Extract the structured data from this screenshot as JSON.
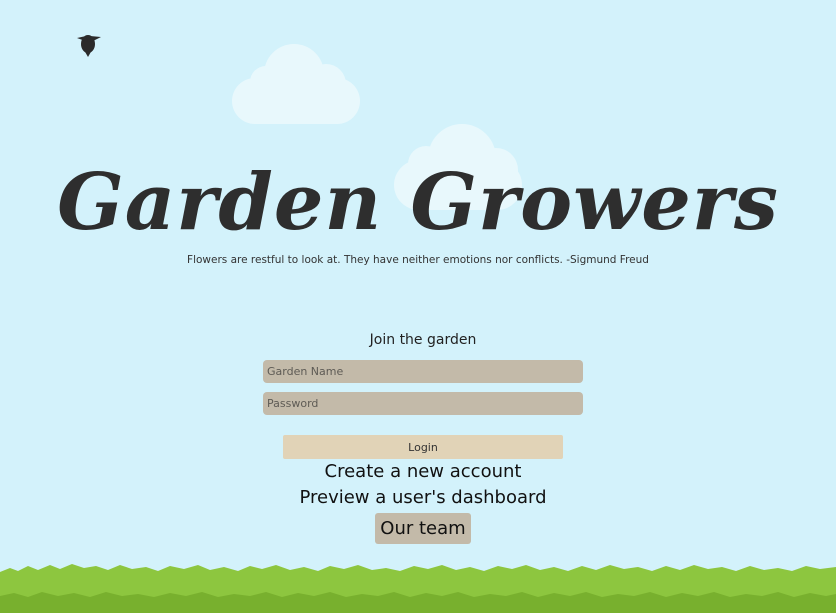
{
  "header": {
    "title": "Garden Growers",
    "quote": "Flowers are restful to look at. They have neither emotions nor conflicts. -Sigmund Freud"
  },
  "login_form": {
    "heading": "Join the garden",
    "garden_name_placeholder": "Garden Name",
    "password_placeholder": "Password",
    "login_label": "Login"
  },
  "links": {
    "create_account": "Create a new account",
    "preview_dashboard": "Preview a user's dashboard",
    "our_team": "Our team"
  },
  "colors": {
    "sky": "#d3f2fb",
    "cloud": "#e8f8fc",
    "title": "#2e2e2e",
    "input_bg": "#c3baa9",
    "login_bg": "#e1d3b7",
    "grass_light": "#8dc63f",
    "grass_dark": "#78b02e"
  },
  "decor": {
    "bird_icon": "bird-icon",
    "cloud_icon": "cloud-icon",
    "grass_icon": "grass-icon"
  }
}
